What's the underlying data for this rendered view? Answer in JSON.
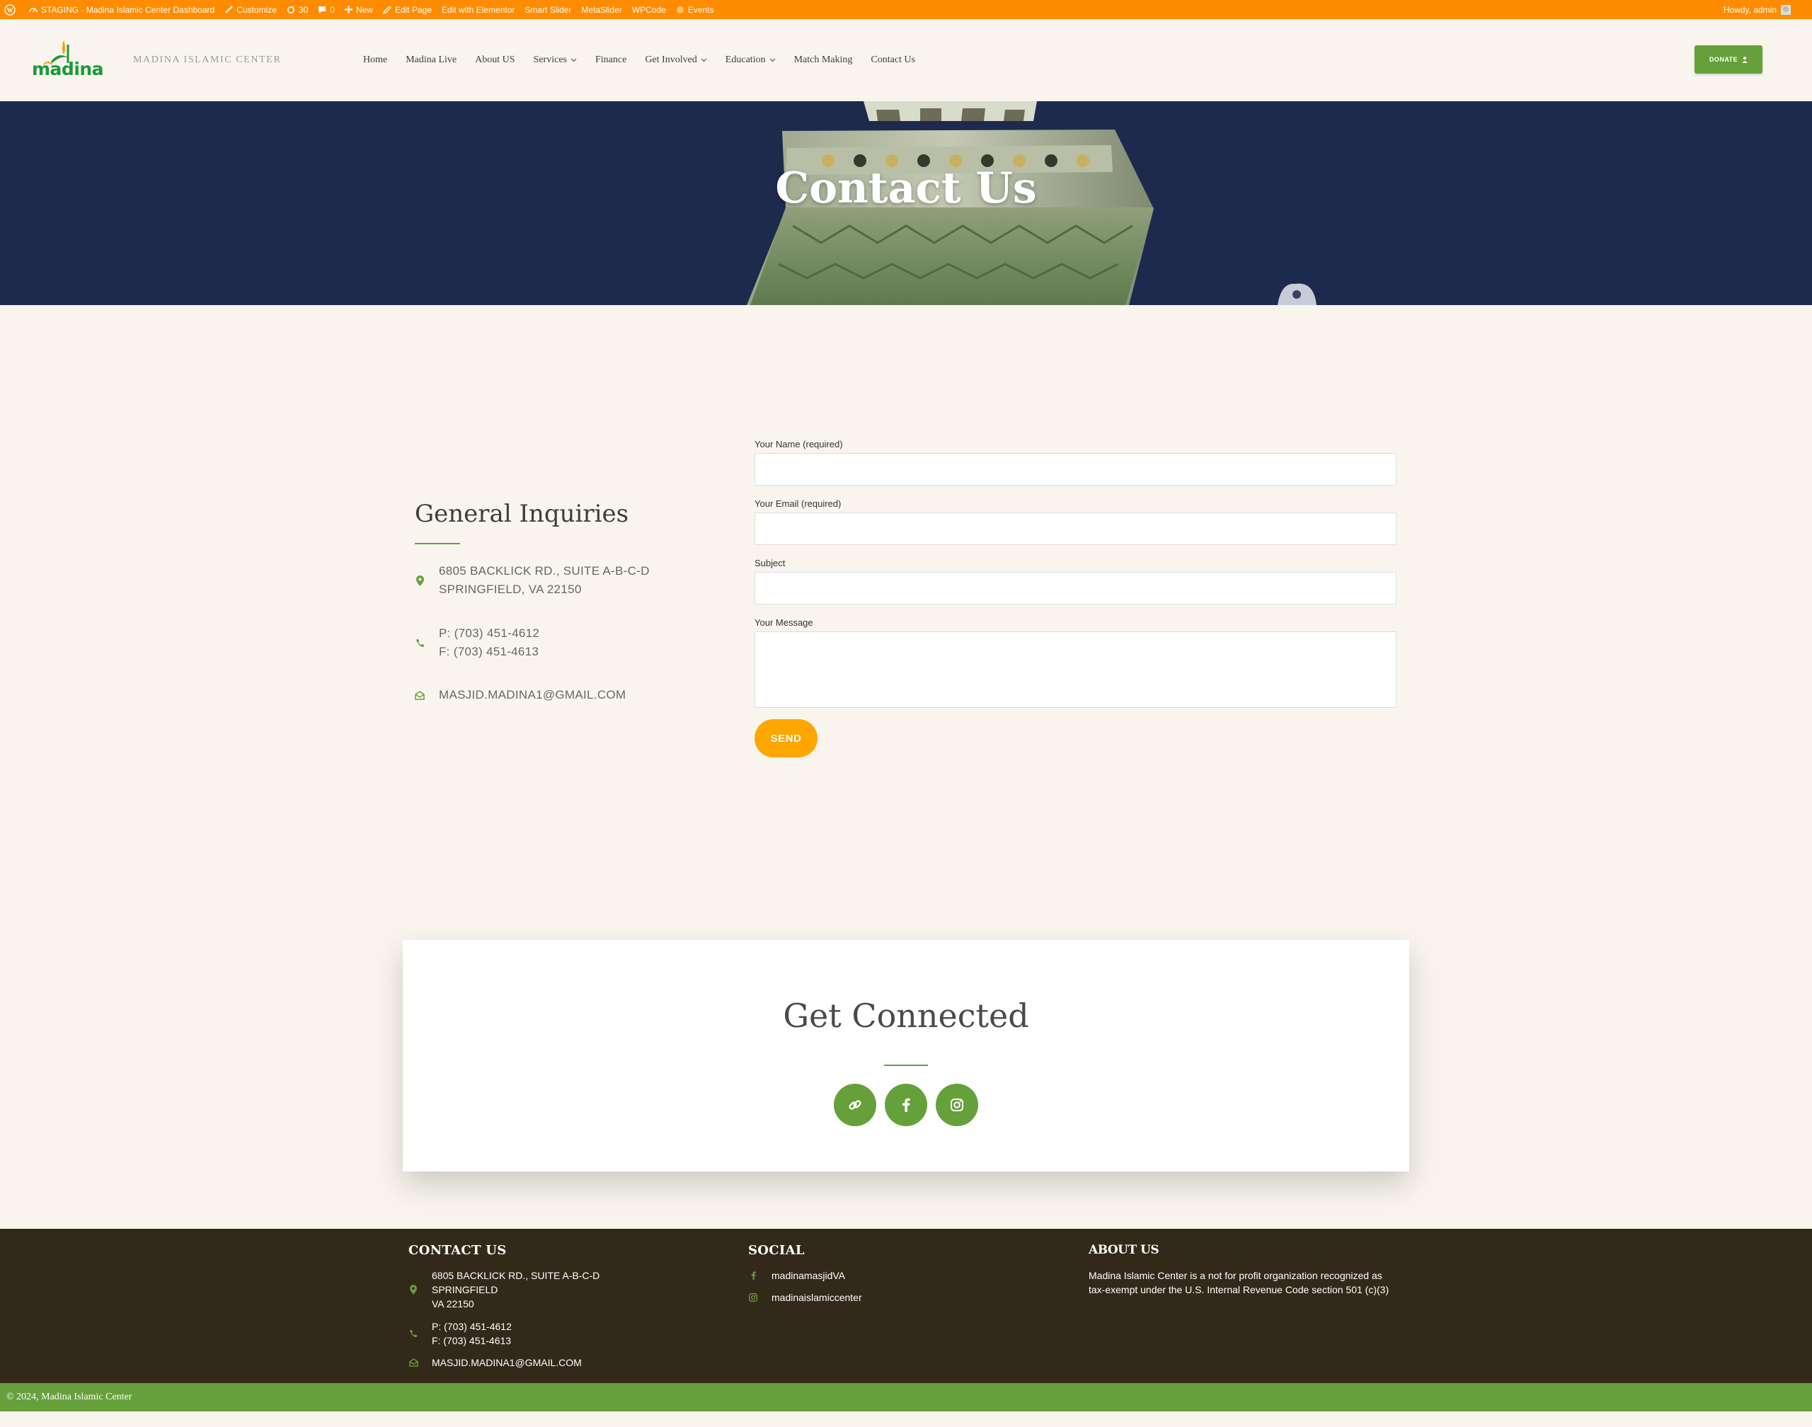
{
  "admin_bar": {
    "site": "STAGING - Madina Islamic Center Dashboard",
    "customize": "Customize",
    "updates_count": "30",
    "comments_count": "0",
    "new": "New",
    "edit_page": "Edit Page",
    "edit_elementor": "Edit with Elementor",
    "smart_slider": "Smart Slider",
    "metaslider": "MetaSlider",
    "wpcode": "WPCode",
    "events": "Events",
    "howdy": "Howdy, admin"
  },
  "header": {
    "logo_text": "madina",
    "site_name": "MADINA ISLAMIC CENTER",
    "nav": [
      "Home",
      "Madina Live",
      "About US",
      "Services",
      "Finance",
      "Get Involved",
      "Education",
      "Match Making",
      "Contact Us"
    ],
    "donate_label": "DONATE"
  },
  "hero": {
    "title": "Contact Us"
  },
  "inquiries": {
    "title": "General Inquiries",
    "address_line1": "6805 BACKLICK RD., SUITE A-B-C-D",
    "address_line2": "SPRINGFIELD, VA 22150",
    "phone": "P: (703) 451-4612",
    "fax": "F: (703) 451-4613",
    "email": "MASJID.MADINA1@GMAIL.COM"
  },
  "form": {
    "name_label": "Your Name (required)",
    "email_label": "Your Email (required)",
    "subject_label": "Subject",
    "message_label": "Your Message",
    "send_label": "SEND"
  },
  "connect": {
    "title": "Get Connected"
  },
  "footer": {
    "contact_title": "CONTACT US",
    "address1": "6805 BACKLICK RD., SUITE A-B-C-D",
    "address2": "SPRINGFIELD",
    "address3": "VA 22150",
    "phone": "P: (703) 451-4612",
    "fax": "F: (703) 451-4613",
    "email": "MASJID.MADINA1@GMAIL.COM",
    "social_title": "SOCIAL",
    "facebook": "madinamasjidVA",
    "instagram": "madinaislamiccenter",
    "about_title": "ABOUT US",
    "about_text": "Madina Islamic Center is a not for profit organization recognized as tax-exempt under the U.S. Internal Revenue Code section 501 (c)(3)"
  },
  "copyright": "© 2024, Madina Islamic Center",
  "colors": {
    "accent_green": "#66a03b",
    "admin_orange": "#ff8c00",
    "send_orange": "#ffa500",
    "hero_navy": "#1d2a4e",
    "footer_brown": "#33291a"
  }
}
